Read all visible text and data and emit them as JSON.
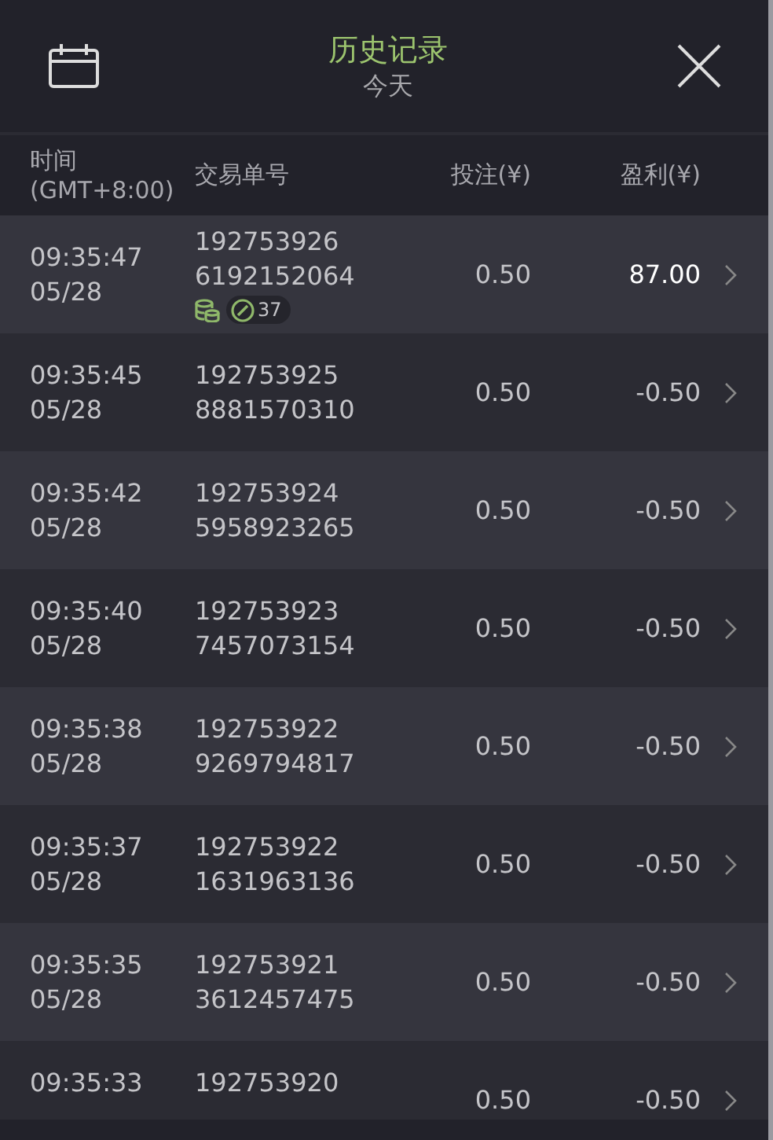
{
  "header": {
    "title": "历史记录",
    "subtitle": "今天"
  },
  "columns": [
    {
      "label": "时间",
      "sublabel": "(GMT+8:00)"
    },
    {
      "label": "交易单号"
    },
    {
      "label": "投注(¥)"
    },
    {
      "label": "盈利(¥)"
    }
  ],
  "rows": [
    {
      "time": "09:35:47",
      "date": "05/28",
      "order": [
        "192753926",
        "6192152064"
      ],
      "badge": "37",
      "stake": "0.50",
      "profit": "87.00",
      "won": true
    },
    {
      "time": "09:35:45",
      "date": "05/28",
      "order": [
        "192753925",
        "8881570310"
      ],
      "stake": "0.50",
      "profit": "-0.50",
      "won": false
    },
    {
      "time": "09:35:42",
      "date": "05/28",
      "order": [
        "192753924",
        "5958923265"
      ],
      "stake": "0.50",
      "profit": "-0.50",
      "won": false
    },
    {
      "time": "09:35:40",
      "date": "05/28",
      "order": [
        "192753923",
        "7457073154"
      ],
      "stake": "0.50",
      "profit": "-0.50",
      "won": false
    },
    {
      "time": "09:35:38",
      "date": "05/28",
      "order": [
        "192753922",
        "9269794817"
      ],
      "stake": "0.50",
      "profit": "-0.50",
      "won": false
    },
    {
      "time": "09:35:37",
      "date": "05/28",
      "order": [
        "192753922",
        "1631963136"
      ],
      "stake": "0.50",
      "profit": "-0.50",
      "won": false
    },
    {
      "time": "09:35:35",
      "date": "05/28",
      "order": [
        "192753921",
        "3612457475"
      ],
      "stake": "0.50",
      "profit": "-0.50",
      "won": false
    },
    {
      "time": "09:35:33",
      "order": [
        "192753920"
      ],
      "stake": "0.50",
      "profit": "-0.50",
      "won": false
    }
  ]
}
